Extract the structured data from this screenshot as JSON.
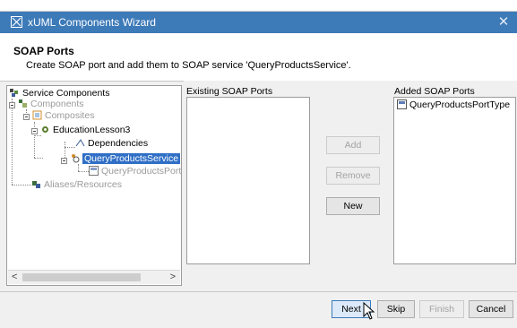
{
  "window": {
    "title": "xUML Components Wizard",
    "close_label": "✕"
  },
  "header": {
    "title": "SOAP Ports",
    "subtitle": "Create SOAP port and add them to SOAP service 'QueryProductsService'."
  },
  "tree": {
    "items": [
      {
        "label": "Service Components"
      },
      {
        "label": "Components"
      },
      {
        "label": "Composites"
      },
      {
        "label": "EducationLesson3"
      },
      {
        "label": "Dependencies"
      },
      {
        "label": "QueryProductsService"
      },
      {
        "label": "QueryProductsPort"
      },
      {
        "label": "Aliases/Resources"
      }
    ],
    "scroll_left": "<",
    "scroll_right": ">"
  },
  "existing_ports": {
    "label": "Existing SOAP Ports",
    "items": []
  },
  "added_ports": {
    "label": "Added SOAP Ports",
    "items": [
      {
        "label": "QueryProductsPortType"
      }
    ]
  },
  "actions": {
    "add": "Add",
    "remove": "Remove",
    "new": "New"
  },
  "footer": {
    "next": "Next",
    "skip": "Skip",
    "finish": "Finish",
    "cancel": "Cancel"
  }
}
